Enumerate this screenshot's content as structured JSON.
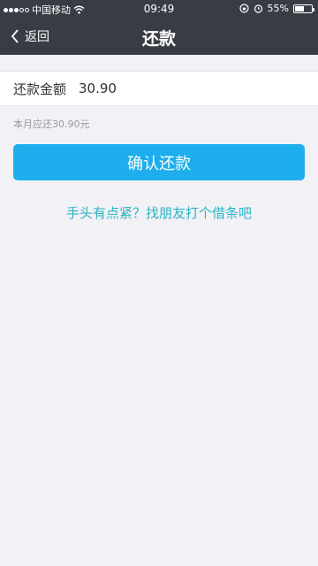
{
  "status_bar": {
    "carrier": "中国移动",
    "time": "09:49",
    "battery_percent": "55%",
    "battery_level": 0.55,
    "icons": [
      "signal-dots-icon",
      "wifi-icon",
      "rotation-lock-icon",
      "alarm-icon",
      "battery-icon"
    ]
  },
  "nav": {
    "back_label": "返回",
    "title": "还款"
  },
  "form": {
    "amount_label": "还款金额",
    "amount_value": "30.90",
    "hint": "本月应还30.90元"
  },
  "actions": {
    "confirm_label": "确认还款",
    "friend_link": "手头有点紧？找朋友打个借条吧"
  },
  "colors": {
    "header_bg": "#3a3c45",
    "accent_blue": "#1eaeed",
    "link_teal": "#2bb5c5",
    "page_bg": "#f2f1f6"
  }
}
